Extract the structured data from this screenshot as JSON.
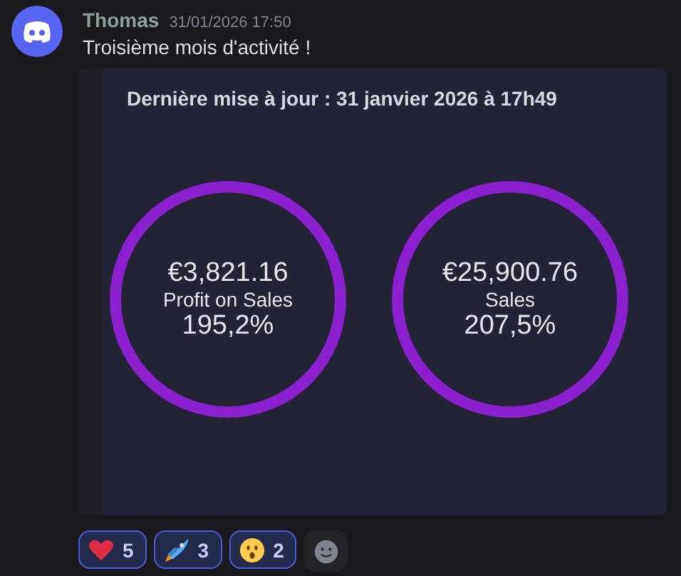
{
  "message": {
    "author": "Thomas",
    "timestamp": "31/01/2026 17:50",
    "text": "Troisième mois d'activité !"
  },
  "embed": {
    "title": "Dernière mise à jour : 31 janvier 2026 à 17h49",
    "stats": [
      {
        "amount": "€3,821.16",
        "label": "Profit on Sales",
        "percent": "195,2%"
      },
      {
        "amount": "€25,900.76",
        "label": "Sales",
        "percent": "207,5%"
      }
    ]
  },
  "reactions": [
    {
      "kind": "heart",
      "count": "5",
      "selected": true
    },
    {
      "kind": "rocket",
      "count": "3",
      "selected": true
    },
    {
      "kind": "surprised",
      "count": "2",
      "selected": true
    }
  ]
}
